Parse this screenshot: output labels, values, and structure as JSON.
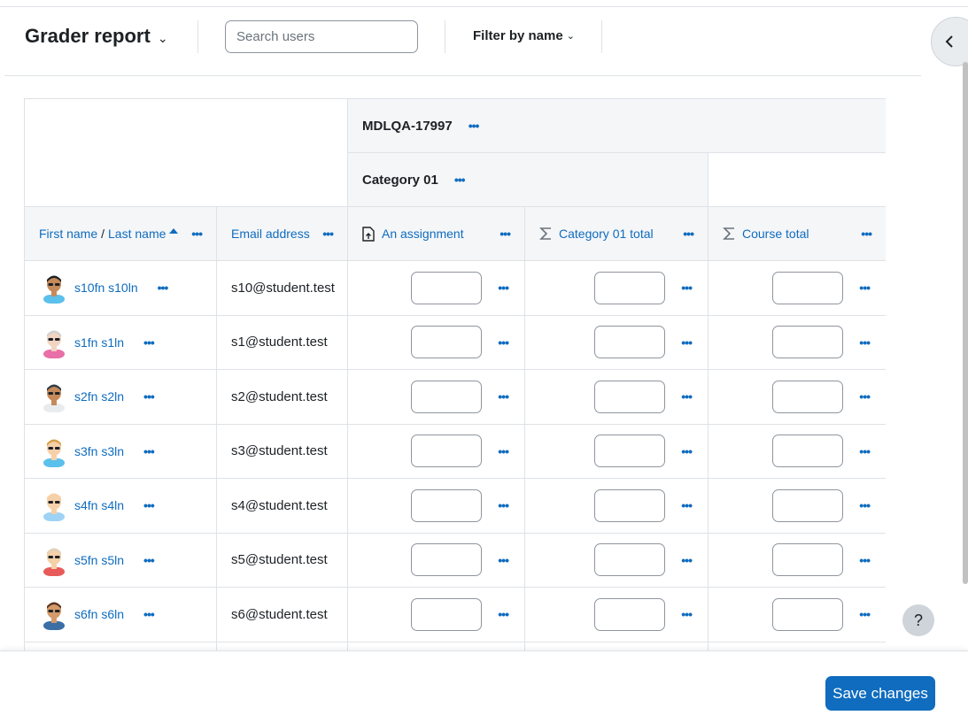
{
  "header": {
    "title": "Grader report",
    "search_placeholder": "Search users",
    "filter_label": "Filter by name"
  },
  "table": {
    "course_name": "MDLQA-17997",
    "category_name": "Category 01",
    "columns": {
      "first_name": "First name",
      "separator": "/",
      "last_name": "Last name",
      "email": "Email address",
      "assignment": "An assignment",
      "category_total": "Category 01 total",
      "course_total": "Course total"
    },
    "rows": [
      {
        "name": "s10fn s10ln",
        "email": "s10@student.test"
      },
      {
        "name": "s1fn s1ln",
        "email": "s1@student.test"
      },
      {
        "name": "s2fn s2ln",
        "email": "s2@student.test"
      },
      {
        "name": "s3fn s3ln",
        "email": "s3@student.test"
      },
      {
        "name": "s4fn s4ln",
        "email": "s4@student.test"
      },
      {
        "name": "s5fn s5ln",
        "email": "s5@student.test"
      },
      {
        "name": "s6fn s6ln",
        "email": "s6@student.test"
      }
    ]
  },
  "footer": {
    "save_label": "Save changes",
    "help_label": "?"
  },
  "icons": {
    "drawer_toggle": "chevron-left-icon",
    "assignment": "assignment-icon",
    "total": "sigma-icon",
    "sort": "sort-up-icon",
    "menu": "more-dots-icon"
  },
  "colors": {
    "link": "#0f6cbf",
    "primary_button": "#0f6cbf",
    "header_bg": "#f5f6f8"
  }
}
